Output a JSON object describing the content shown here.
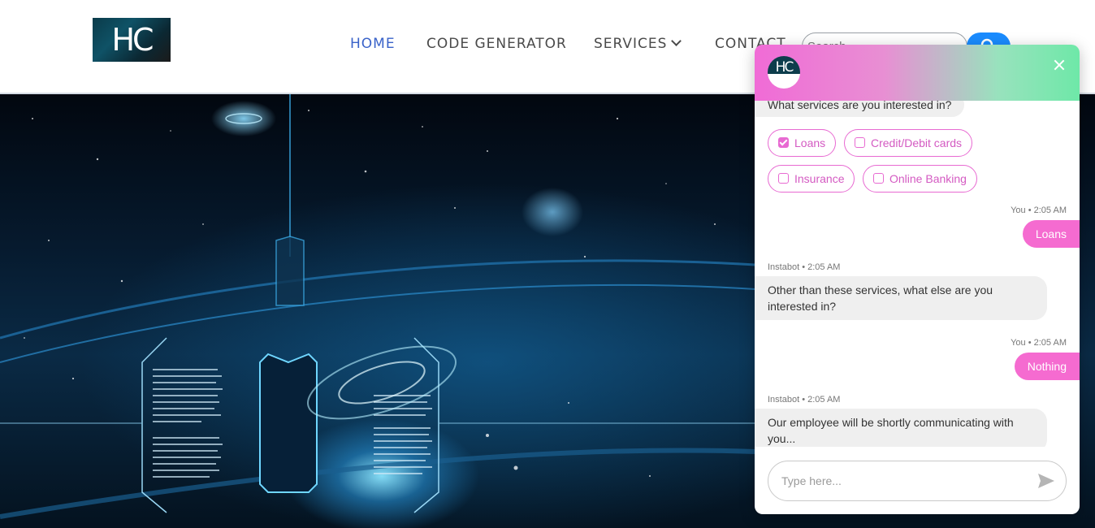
{
  "header": {
    "logo_text": "HC",
    "nav": [
      {
        "label": "HOME",
        "active": true
      },
      {
        "label": "CODE GENERATOR",
        "active": false
      },
      {
        "label": "SERVICES",
        "active": false
      },
      {
        "label": "CONTACT",
        "active": false
      }
    ],
    "search": {
      "placeholder": "Search",
      "button_icon": "search-icon"
    }
  },
  "chat": {
    "avatar_text": "HC",
    "close_icon": "close-icon",
    "question": "What services are you interested in?",
    "options": [
      {
        "label": "Loans",
        "checked": true
      },
      {
        "label": "Credit/Debit cards",
        "checked": false
      },
      {
        "label": "Insurance",
        "checked": false
      },
      {
        "label": "Online Banking",
        "checked": false
      }
    ],
    "messages": [
      {
        "sender": "You",
        "time": "2:05 AM",
        "meta": "You • 2:05 AM",
        "text": "Loans"
      },
      {
        "sender": "Instabot",
        "time": "2:05 AM",
        "meta": "Instabot • 2:05 AM",
        "text": "Other than these services, what else are you interested in?"
      },
      {
        "sender": "You",
        "time": "2:05 AM",
        "meta": "You • 2:05 AM",
        "text": "Nothing"
      },
      {
        "sender": "Instabot",
        "time": "2:05 AM",
        "meta": "Instabot • 2:05 AM",
        "text": "Our employee will be shortly communicating with you..."
      }
    ],
    "input_placeholder": "Type here...",
    "send_icon": "send-icon"
  },
  "colors": {
    "nav_active": "#3a63c9",
    "accent_pink": "#f56bd0",
    "search_button": "#1a8cff"
  }
}
